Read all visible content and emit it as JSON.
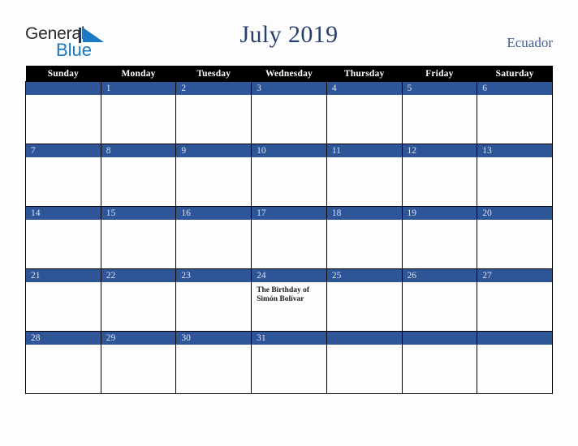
{
  "brand": {
    "name_part1": "General",
    "name_part2": "Blue",
    "triangle_icon": "blue-triangle-icon",
    "accent_color": "#1b78c2"
  },
  "header": {
    "title": "July 2019",
    "country": "Ecuador",
    "title_color": "#27406d",
    "country_color": "#46618f"
  },
  "calendar": {
    "header_bg": "#000000",
    "daynum_band_color": "#2e5598",
    "daynum_text_color": "#dbe2ef",
    "weekday_headers": [
      "Sunday",
      "Monday",
      "Tuesday",
      "Wednesday",
      "Thursday",
      "Friday",
      "Saturday"
    ],
    "weeks": [
      [
        {
          "day": "",
          "events": []
        },
        {
          "day": "1",
          "events": []
        },
        {
          "day": "2",
          "events": []
        },
        {
          "day": "3",
          "events": []
        },
        {
          "day": "4",
          "events": []
        },
        {
          "day": "5",
          "events": []
        },
        {
          "day": "6",
          "events": []
        }
      ],
      [
        {
          "day": "7",
          "events": []
        },
        {
          "day": "8",
          "events": []
        },
        {
          "day": "9",
          "events": []
        },
        {
          "day": "10",
          "events": []
        },
        {
          "day": "11",
          "events": []
        },
        {
          "day": "12",
          "events": []
        },
        {
          "day": "13",
          "events": []
        }
      ],
      [
        {
          "day": "14",
          "events": []
        },
        {
          "day": "15",
          "events": []
        },
        {
          "day": "16",
          "events": []
        },
        {
          "day": "17",
          "events": []
        },
        {
          "day": "18",
          "events": []
        },
        {
          "day": "19",
          "events": []
        },
        {
          "day": "20",
          "events": []
        }
      ],
      [
        {
          "day": "21",
          "events": []
        },
        {
          "day": "22",
          "events": []
        },
        {
          "day": "23",
          "events": []
        },
        {
          "day": "24",
          "events": [
            "The Birthday of Simón Bolívar"
          ]
        },
        {
          "day": "25",
          "events": []
        },
        {
          "day": "26",
          "events": []
        },
        {
          "day": "27",
          "events": []
        }
      ],
      [
        {
          "day": "28",
          "events": []
        },
        {
          "day": "29",
          "events": []
        },
        {
          "day": "30",
          "events": []
        },
        {
          "day": "31",
          "events": []
        },
        {
          "day": "",
          "events": []
        },
        {
          "day": "",
          "events": []
        },
        {
          "day": "",
          "events": []
        }
      ]
    ]
  }
}
